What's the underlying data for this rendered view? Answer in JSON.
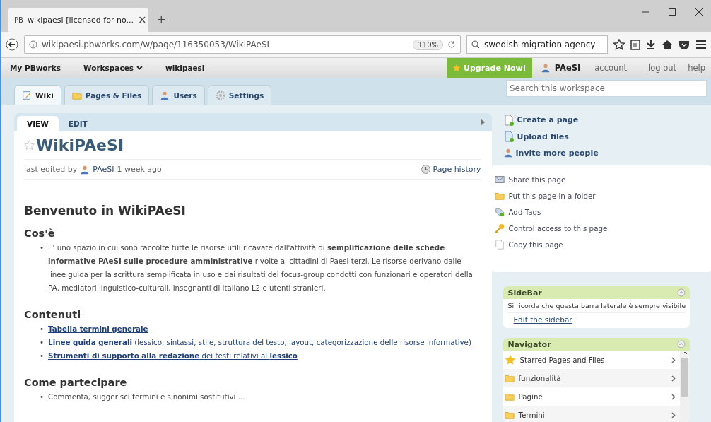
{
  "browser": {
    "tab": {
      "favicon": "PB",
      "title": "wikipaesi [licensed for no...",
      "close": "×"
    },
    "new_tab": "+",
    "url": "wikipaesi.pbworks.com/w/page/116350053/WikiPAeSI",
    "zoom": "110%",
    "search": "swedish migration agency"
  },
  "topnav": {
    "crumbs": [
      {
        "label": "My PBworks",
        "dropdown": false
      },
      {
        "label": "Workspaces",
        "dropdown": true
      },
      {
        "label": "wikipaesi",
        "dropdown": false
      }
    ],
    "upgrade": "Upgrade Now!",
    "user": "PAeSI",
    "links": [
      "account",
      "log out",
      "help"
    ]
  },
  "tabs": [
    {
      "label": "Wiki",
      "kind": "wiki",
      "selected": true
    },
    {
      "label": "Pages & Files",
      "kind": "folder",
      "selected": false
    },
    {
      "label": "Users",
      "kind": "users",
      "selected": false
    },
    {
      "label": "Settings",
      "kind": "gear",
      "selected": false
    }
  ],
  "workspace_search": {
    "placeholder": "Search this workspace"
  },
  "page": {
    "modes": [
      {
        "label": "VIEW",
        "selected": true
      },
      {
        "label": "EDIT",
        "selected": false
      }
    ],
    "title": "WikiPAeSI",
    "starred": false,
    "edited_prefix": "last edited by",
    "editor": "PAeSI",
    "edited_when": "1 week ago",
    "history": "Page history",
    "heading": "Benvenuto in WikiPAeSI",
    "sections": [
      {
        "title": "Cos'è",
        "items": [
          {
            "kind": "text",
            "marker": "•",
            "text": "E' uno spazio in cui sono raccolte tutte le risorse utili ricavate dall'attività di **semplificazione delle schede informative PAeSI sulle procedure amministrative** rivolte ai cittadini di Paesi terzi. Le risorse derivano dalle linee guida per la scrittura semplificata in uso e dai risultati dei focus-group condotti con funzionari e operatori della PA, mediatori linguistico-culturali, insegnanti di italiano L2 e utenti stranieri."
          }
        ]
      },
      {
        "title": "Contenuti",
        "items": [
          {
            "kind": "link",
            "marker": "•",
            "text": "**Tabella termini generale**"
          },
          {
            "kind": "link",
            "marker": "•",
            "text": "**Linee guida generali** (lessico, sintassi, stile, struttura del testo, layout, categorizzazione delle risorse informative)"
          },
          {
            "kind": "link",
            "marker": "•",
            "text": "**Strumenti di supporto alla redazione** dei testi relativi al **lessico**"
          }
        ]
      },
      {
        "title": "Come partecipare",
        "items": [
          {
            "kind": "text",
            "marker": "•",
            "text": "Commenta, suggerisci termini e sinonimi sostitutivi ..."
          }
        ]
      }
    ]
  },
  "actions": [
    {
      "label": "Create a page",
      "kind": "page"
    },
    {
      "label": "Upload files",
      "kind": "upload"
    },
    {
      "label": "Invite more people",
      "kind": "person"
    }
  ],
  "page_actions": [
    {
      "label": "Share this page",
      "kind": "mail"
    },
    {
      "label": "Put this page in a folder",
      "kind": "folder"
    },
    {
      "label": "Add Tags",
      "kind": "tag"
    },
    {
      "label": "Control access to this page",
      "kind": "key"
    },
    {
      "label": "Copy this page",
      "kind": "copy"
    }
  ],
  "sidebar": {
    "title": "SideBar",
    "text": "Si ricorda che questa barra laterale è sempre visibile",
    "edit": "Edit the sidebar"
  },
  "navigator": {
    "title": "Navigator",
    "items": [
      {
        "label": "Starred Pages and Files",
        "kind": "star"
      },
      {
        "label": "funzionalità",
        "kind": "folder"
      },
      {
        "label": "Pagine",
        "kind": "folder"
      },
      {
        "label": "Termini",
        "kind": "folder"
      }
    ]
  }
}
